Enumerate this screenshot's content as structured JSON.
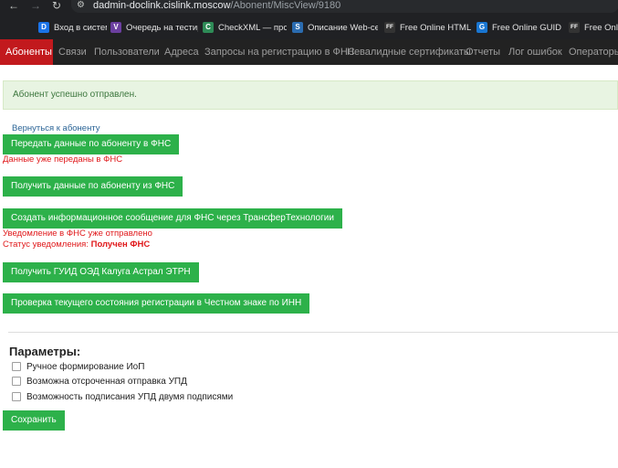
{
  "browser": {
    "url_host": "dadmin-doclink.cislink.moscow",
    "url_path": "/Abonent/MiscView/9180",
    "bookmarks": [
      {
        "label": "Вход в систему",
        "icon": "D",
        "color": "#1a73e8"
      },
      {
        "label": "Очередь на тестир...",
        "icon": "V",
        "color": "#6b3fa0"
      },
      {
        "label": "CheckXML — пров...",
        "icon": "C",
        "color": "#2e8b57"
      },
      {
        "label": "Описание Web-сер...",
        "icon": "S",
        "color": "#2b6cb0"
      },
      {
        "label": "Free Online HTML F...",
        "icon": "FF",
        "color": "#333333"
      },
      {
        "label": "Free Online GUID G...",
        "icon": "G",
        "color": "#1976d2"
      },
      {
        "label": "Free Online",
        "icon": "FF",
        "color": "#333333"
      }
    ]
  },
  "nav": {
    "tabs": [
      "Абоненты",
      "Связи",
      "Пользователи",
      "Адреса",
      "Запросы на регистрацию в ФНС",
      "Невалидные сертификаты",
      "Отчеты",
      "Лог ошибок",
      "Операторы"
    ]
  },
  "alert": {
    "text": "Абонент успешно отправлен."
  },
  "back_link": "Вернуться к абоненту",
  "actions": {
    "send_fns": "Передать данные по абоненту в ФНС",
    "sent_note": "Данные уже переданы в ФНС",
    "get_fns": "Получить данные по абоненту из ФНС",
    "create_message": "Создать информационное сообщение для ФНС через ТрансферТехнологии",
    "notice_sent": "Уведомление в ФНС уже отправлено",
    "status_label": "Статус уведомления:",
    "status_value": "Получен ФНС",
    "get_guid": "Получить ГУИД ОЭД Калуга Астрал ЭТРН",
    "check_status": "Проверка текущего состояния регистрации в Честном знаке по ИНН"
  },
  "params": {
    "title": "Параметры:",
    "options": [
      {
        "label": "Ручное формирование ИоП",
        "checked": false
      },
      {
        "label": "Возможна отсроченная отправка УПД",
        "checked": false
      },
      {
        "label": "Возможность подписания УПД двумя подписями",
        "checked": false
      }
    ],
    "save": "Сохранить"
  }
}
